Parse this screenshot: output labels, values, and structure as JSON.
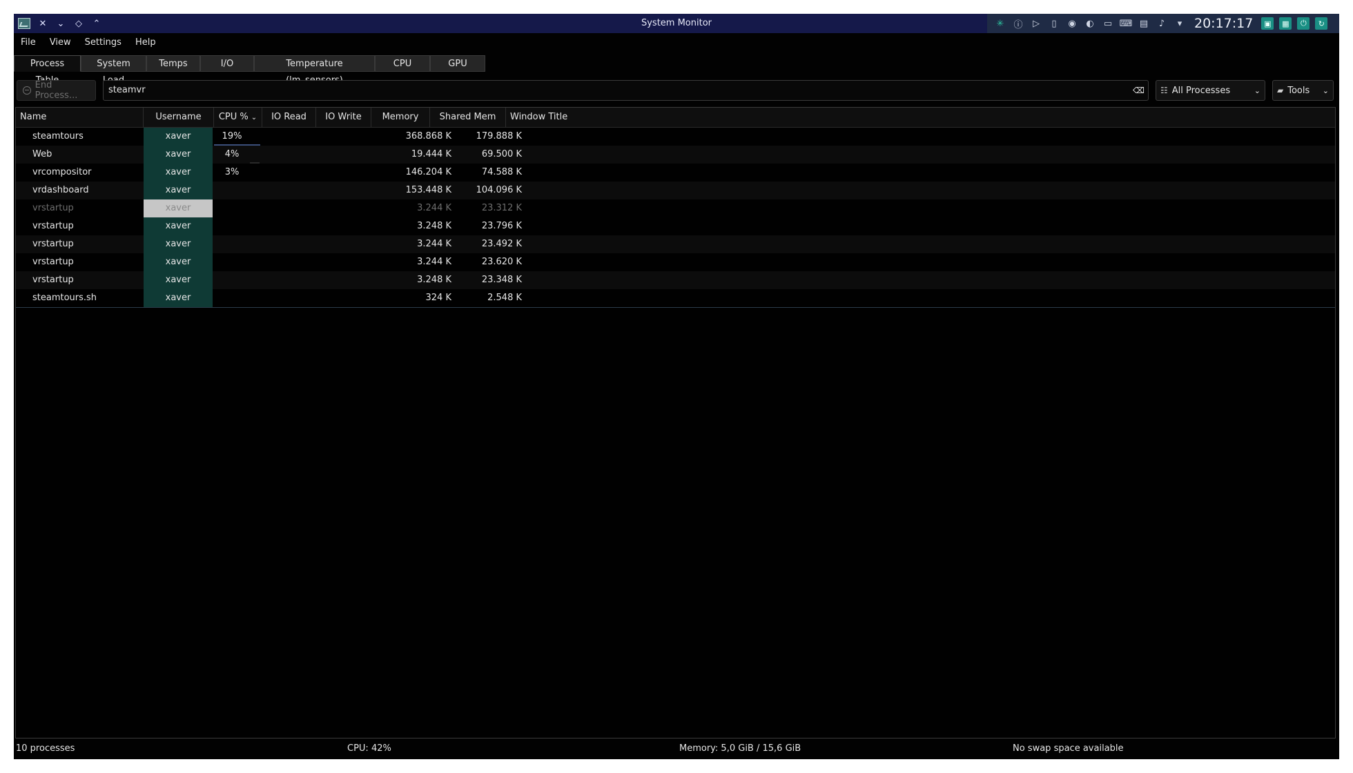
{
  "window": {
    "title": "System Monitor"
  },
  "tray": {
    "clock": "20:17:17"
  },
  "menu": [
    "File",
    "View",
    "Settings",
    "Help"
  ],
  "tabs": [
    {
      "label": "Process Table"
    },
    {
      "label": "System Load"
    },
    {
      "label": "Temps"
    },
    {
      "label": "I/O"
    },
    {
      "label": "Temperature (lm_sensors)"
    },
    {
      "label": "CPU"
    },
    {
      "label": "GPU"
    }
  ],
  "toolbar": {
    "end_process_label": "End Process...",
    "search_value": "steamvr",
    "filter_label": "All Processes",
    "tools_label": "Tools"
  },
  "table": {
    "columns": [
      "Name",
      "Username",
      "CPU %",
      "IO Read",
      "IO Write",
      "Memory",
      "Shared Mem",
      "Window Title"
    ],
    "rows": [
      {
        "name": "steamtours",
        "user": "xaver",
        "cpu": "19%",
        "memory": "368.868 K",
        "shared": "179.888 K"
      },
      {
        "name": "Web",
        "user": "xaver",
        "cpu": "4%",
        "memory": "19.444 K",
        "shared": "69.500 K"
      },
      {
        "name": "vrcompositor",
        "user": "xaver",
        "cpu": "3%",
        "memory": "146.204 K",
        "shared": "74.588 K"
      },
      {
        "name": "vrdashboard",
        "user": "xaver",
        "cpu": "",
        "memory": "153.448 K",
        "shared": "104.096 K"
      },
      {
        "name": "vrstartup",
        "user": "xaver",
        "cpu": "",
        "memory": "3.244 K",
        "shared": "23.312 K"
      },
      {
        "name": "vrstartup",
        "user": "xaver",
        "cpu": "",
        "memory": "3.248 K",
        "shared": "23.796 K"
      },
      {
        "name": "vrstartup",
        "user": "xaver",
        "cpu": "",
        "memory": "3.244 K",
        "shared": "23.492 K"
      },
      {
        "name": "vrstartup",
        "user": "xaver",
        "cpu": "",
        "memory": "3.244 K",
        "shared": "23.620 K"
      },
      {
        "name": "vrstartup",
        "user": "xaver",
        "cpu": "",
        "memory": "3.248 K",
        "shared": "23.348 K"
      },
      {
        "name": "steamtours.sh",
        "user": "xaver",
        "cpu": "",
        "memory": "324 K",
        "shared": "2.548 K"
      }
    ]
  },
  "status": {
    "processes": "10 processes",
    "cpu": "CPU: 42%",
    "memory": "Memory: 5,0 GiB / 15,6 GiB",
    "swap": "No swap space available"
  }
}
